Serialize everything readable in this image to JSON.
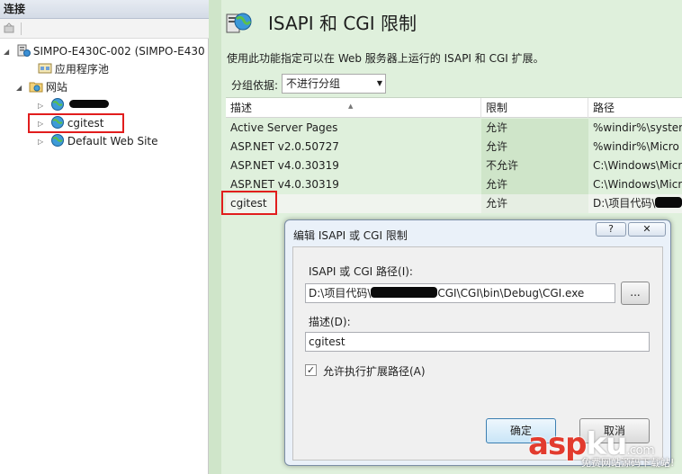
{
  "connections_pane": {
    "title": "连接",
    "tree": {
      "server": "SIMPO-E430C-002 (SIMPO-E430",
      "app_pools": "应用程序池",
      "sites": "网站",
      "site_redacted": "",
      "site_cgitest": "cgitest",
      "site_default": "Default Web Site"
    }
  },
  "feature_page": {
    "title": "ISAPI 和 CGI 限制",
    "description": "使用此功能指定可以在 Web 服务器上运行的 ISAPI 和 CGI 扩展。",
    "group_by_label": "分组依据:",
    "group_by_value": "不进行分组",
    "columns": [
      "描述",
      "限制",
      "路径"
    ],
    "rows": [
      {
        "description": "Active Server Pages",
        "restriction": "允许",
        "path": "%windir%\\system"
      },
      {
        "description": "ASP.NET v2.0.50727",
        "restriction": "允许",
        "path": "%windir%\\Micro"
      },
      {
        "description": "ASP.NET v4.0.30319",
        "restriction": "不允许",
        "path": "C:\\Windows\\Micr"
      },
      {
        "description": "ASP.NET v4.0.30319",
        "restriction": "允许",
        "path": "C:\\Windows\\Micr"
      },
      {
        "description": "cgitest",
        "restriction": "允许",
        "path": "D:\\项目代码\\"
      }
    ]
  },
  "dialog": {
    "title": "编辑 ISAPI 或 CGI 限制",
    "help_label": "?",
    "close_label": "✕",
    "path_label": "ISAPI 或 CGI 路径(I):",
    "path_value_prefix": "D:\\项目代码\\",
    "path_value_suffix": "CGI\\CGI\\bin\\Debug\\CGI.exe",
    "browse_label": "...",
    "description_label": "描述(D):",
    "description_value": "cgitest",
    "allow_extension_label": "允许执行扩展路径(A)",
    "allow_extension_checked": true,
    "ok_label": "确定",
    "cancel_label": "取消"
  },
  "watermark": {
    "brand_a": "asp",
    "brand_b": "ku",
    "brand_c": ".com",
    "subtitle": "免费网站源码下载站!"
  },
  "colors": {
    "feature_bg": "#dff0dc",
    "highlight": "#e11d1d"
  }
}
